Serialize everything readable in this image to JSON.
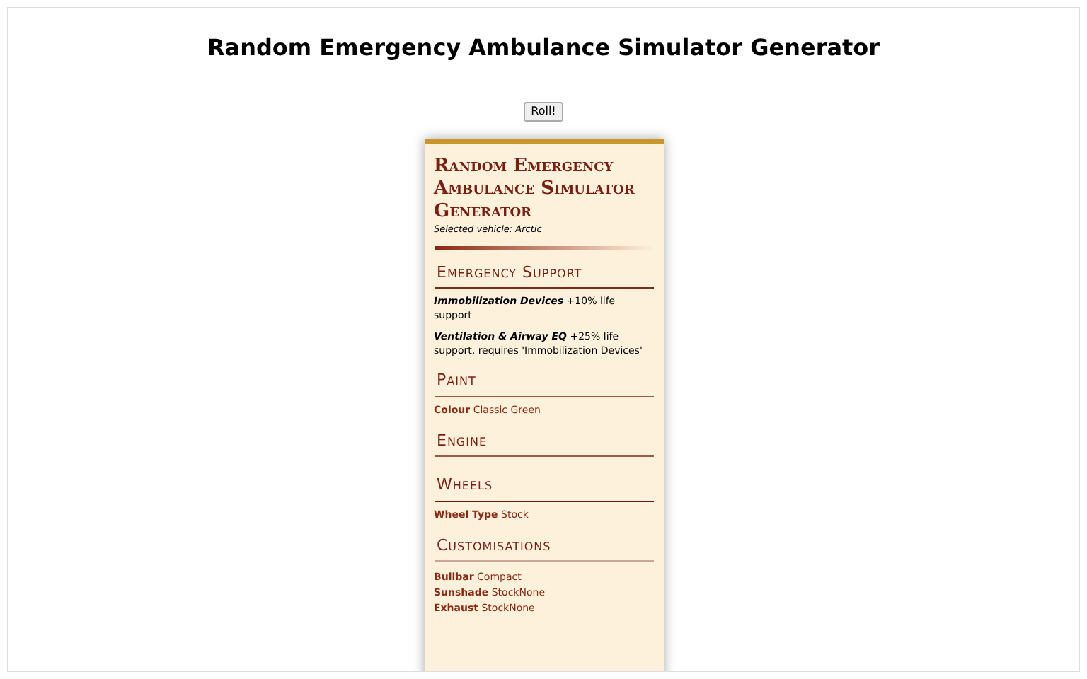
{
  "page_title": "Random Emergency Ambulance Simulator Generator",
  "roll_button": "Roll!",
  "sheet": {
    "title": "Random Emergency Ambulance Simulator Generator",
    "subtitle": "Selected vehicle: Arctic",
    "sections": [
      {
        "heading": "Emergency Support",
        "color": "#7a2a18",
        "kind": "feature",
        "items": [
          {
            "label": "Immobilization Devices",
            "text": "+10% life support"
          },
          {
            "label": "Ventilation & Airway EQ",
            "text": "+25% life support, requires 'Immobilization Devices'"
          }
        ]
      },
      {
        "heading": "Paint",
        "color": "#9a5a48",
        "kind": "pair",
        "items": [
          {
            "label": "Colour",
            "text": "Classic Green"
          }
        ]
      },
      {
        "heading": "Engine",
        "color": "#9a5a48",
        "kind": "pair"
      },
      {
        "heading": "Wheels",
        "color": "#6a1a0a",
        "kind": "pair",
        "items": [
          {
            "label": "Wheel Type",
            "text": "Stock"
          }
        ]
      },
      {
        "heading": "Customisations",
        "color": "#c8a898",
        "kind": "list",
        "items": [
          {
            "label": "Bullbar",
            "text": "Compact"
          },
          {
            "label": "Sunshade",
            "text": "StockNone"
          },
          {
            "label": "Exhaust",
            "text": "StockNone"
          }
        ]
      }
    ]
  }
}
